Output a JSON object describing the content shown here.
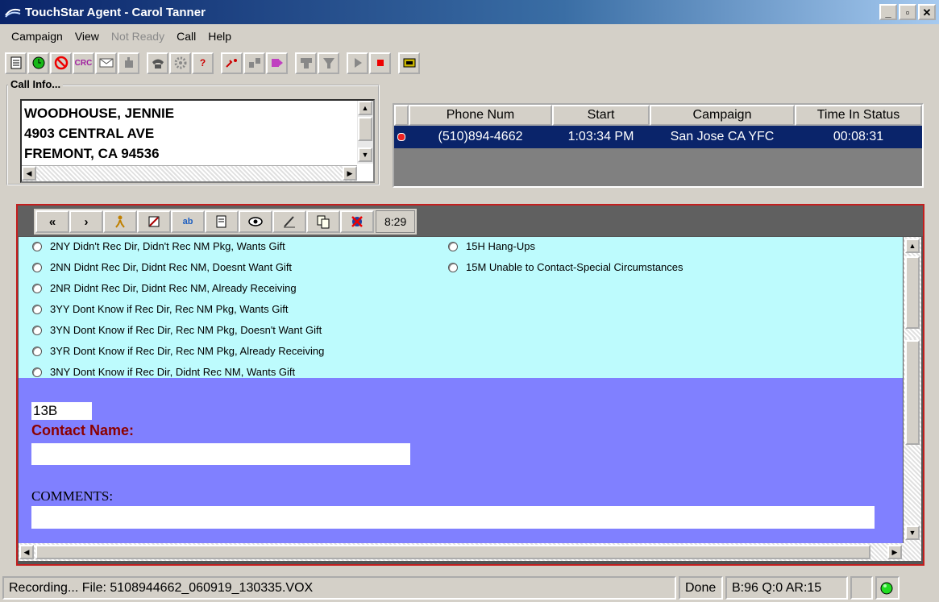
{
  "window": {
    "title": "TouchStar Agent - Carol Tanner",
    "buttons": {
      "minimize": "_",
      "maximize": "▫",
      "close": "✕"
    }
  },
  "menu": {
    "campaign": "Campaign",
    "view": "View",
    "not_ready": "Not Ready",
    "call": "Call",
    "help": "Help"
  },
  "toolbar": {
    "icons": [
      "notepad-icon",
      "go-green-icon",
      "stop-icon",
      "crc-icon",
      "mail-icon",
      "dial-hand-icon",
      "phone-icon",
      "gear-icon",
      "help-icon",
      "transfer-icon",
      "conference-icon",
      "forward-icon",
      "hold-icon",
      "hold2-icon",
      "play-icon",
      "record-stop-icon",
      "cash-icon"
    ],
    "crc_label": "CRC"
  },
  "call_info": {
    "legend": "Call Info...",
    "name": "WOODHOUSE, JENNIE",
    "street": "4903  CENTRAL AVE",
    "city": "FREMONT,  CA 94536"
  },
  "call_grid": {
    "columns": [
      "Phone Num",
      "Start",
      "Campaign",
      "Time In Status"
    ],
    "rows": [
      {
        "phone": "(510)894-4662",
        "start": "1:03:34 PM",
        "campaign": "San Jose CA YFC",
        "time": "00:08:31"
      }
    ]
  },
  "script_toolbar": {
    "back": "«",
    "next": "›",
    "timer": "8:29"
  },
  "dispositions": {
    "left": [
      "2NY Didn't Rec Dir, Didn't Rec NM Pkg, Wants Gift",
      "2NN Didnt Rec Dir, Didnt Rec NM, Doesnt Want Gift",
      "2NR Didnt Rec Dir, Didnt Rec NM, Already Receiving",
      "3YY Dont Know if Rec Dir, Rec NM Pkg, Wants Gift",
      "3YN Dont Know if Rec Dir, Rec NM Pkg, Doesn't Want Gift",
      "3YR Dont Know if Rec Dir, Rec NM Pkg, Already Receiving",
      "3NY Dont Know if Rec Dir, Didnt Rec NM, Wants Gift"
    ],
    "right": [
      "15H Hang-Ups",
      "15M Unable to Contact-Special Circumstances"
    ]
  },
  "form": {
    "code": "13B",
    "contact_label": "Contact Name:",
    "contact_value": "",
    "comments_label": "COMMENTS:",
    "comments_value": ""
  },
  "status": {
    "recording": "Recording... File: 5108944662_060919_130335.VOX",
    "done": "Done",
    "stats": "B:96 Q:0 AR:15"
  }
}
